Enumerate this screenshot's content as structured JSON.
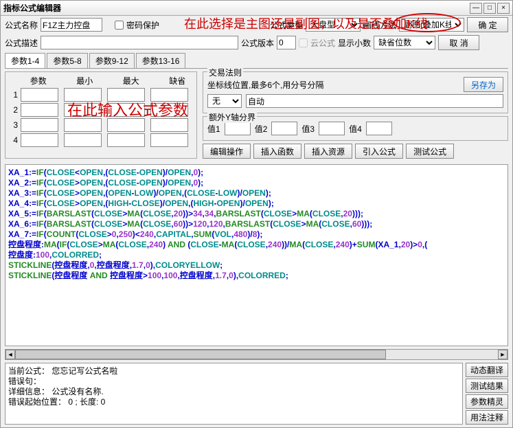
{
  "title": "指标公式编辑器",
  "window_buttons": {
    "min": "—",
    "max": "□",
    "close": "×"
  },
  "row1": {
    "name_label": "公式名称",
    "name_value": "F1Z主力控盘",
    "pwd_label": "密码保护",
    "type_label": "公式类型",
    "type_value": "大盘型",
    "draw_label": "画线方法",
    "draw_value": "副图(叠加K线)",
    "ok": "确  定"
  },
  "row2": {
    "desc_label": "公式描述",
    "desc_value": "",
    "ver_label": "公式版本",
    "ver_value": "0",
    "cloud_label": "云公式",
    "dec_label": "显示小数",
    "dec_value": "缺省位数",
    "cancel": "取  消"
  },
  "tabs": [
    "参数1-4",
    "参数5-8",
    "参数9-12",
    "参数13-16"
  ],
  "param_head": [
    "参数",
    "最小",
    "最大",
    "缺省"
  ],
  "param_nums": [
    "1",
    "2",
    "3",
    "4"
  ],
  "overlay_param": "在此输入公式参数",
  "annot_top": "在此选择是主图还是副图，以及是否叠加K线",
  "trade": {
    "legend": "交易法则",
    "hint": "坐标线位置,最多6个,用分号分隔",
    "save_as": "另存为",
    "none": "无",
    "auto": "自动"
  },
  "extra": {
    "legend": "额外Y轴分界",
    "v1": "值1",
    "v2": "值2",
    "v3": "值3",
    "v4": "值4"
  },
  "btns": {
    "edit": "编辑操作",
    "func": "插入函数",
    "res": "插入资源",
    "import": "引入公式",
    "test": "测试公式"
  },
  "code_lines": [
    [
      "XA_1:=",
      "IF",
      "(",
      "CLOSE",
      "<",
      "OPEN",
      ",(",
      "CLOSE",
      "-",
      "OPEN",
      ")/",
      "OPEN",
      ",",
      "0",
      ");"
    ],
    [
      "XA_2:=",
      "IF",
      "(",
      "CLOSE",
      ">",
      "OPEN",
      ",(",
      "CLOSE",
      "-",
      "OPEN",
      ")/",
      "OPEN",
      ",",
      "0",
      ");"
    ],
    [
      "XA_3:=",
      "IF",
      "(",
      "CLOSE",
      ">",
      "OPEN",
      ",(",
      "OPEN",
      "-",
      "LOW",
      ")/",
      "OPEN",
      ",(",
      "CLOSE",
      "-",
      "LOW",
      ")/",
      "OPEN",
      ");"
    ],
    [
      "XA_4:=",
      "IF",
      "(",
      "CLOSE",
      ">",
      "OPEN",
      ",(",
      "HIGH",
      "-",
      "CLOSE",
      ")/",
      "OPEN",
      ",(",
      "HIGH",
      "-",
      "OPEN",
      ")/",
      "OPEN",
      ");"
    ],
    [
      "XA_5:=",
      "IF",
      "(",
      "BARSLAST",
      "(",
      "CLOSE",
      ">",
      "MA",
      "(",
      "CLOSE",
      ",",
      "20",
      "))>",
      "34",
      ",",
      "34",
      ",",
      "BARSLAST",
      "(",
      "CLOSE",
      ">",
      "MA",
      "(",
      "CLOSE",
      ",",
      "20",
      ")));"
    ],
    [
      "XA_6:=",
      "IF",
      "(",
      "BARSLAST",
      "(",
      "CLOSE",
      ">",
      "MA",
      "(",
      "CLOSE",
      ",",
      "60",
      "))>",
      "120",
      ",",
      "120",
      ",",
      "BARSLAST",
      "(",
      "CLOSE",
      ">",
      "MA",
      "(",
      "CLOSE",
      ",",
      "60",
      ")));"
    ],
    [
      "XA_7:=",
      "IF",
      "(",
      "COUNT",
      "(",
      "CLOSE",
      ">",
      "0",
      ",",
      "250",
      ")<",
      "240",
      ",",
      "CAPITAL",
      ",",
      "SUM",
      "(",
      "VOL",
      ",",
      "480",
      ")/",
      "8",
      ");"
    ],
    [
      "控盘程度:",
      "MA",
      "(",
      "IF",
      "(",
      "CLOSE",
      ">",
      "MA",
      "(",
      "CLOSE",
      ",",
      "240",
      ")",
      " AND ",
      "(",
      "CLOSE",
      "-",
      "MA",
      "(",
      "CLOSE",
      ",",
      "240",
      "))/",
      "MA",
      "(",
      "CLOSE",
      ",",
      "240",
      ")+",
      "SUM",
      "(XA_1,",
      "20",
      ")>",
      "0",
      ",("
    ],
    [
      "控盘度:",
      "100",
      ",",
      "COLORRED",
      ";"
    ],
    [
      "",
      "STICKLINE",
      "(控盘程度,",
      "0",
      ",控盘程度,",
      "1.7",
      ",",
      "0",
      "),",
      "COLORYELLOW",
      ";"
    ],
    [
      "",
      "STICKLINE",
      "(控盘程度 ",
      "AND",
      " 控盘程度>",
      "100",
      ",",
      "100",
      ",控盘程度,",
      "1.7",
      ",",
      "0",
      "),",
      "COLORRED",
      ";"
    ]
  ],
  "status": {
    "l1": "当前公式：  您忘记写公式名啦",
    "l2": "错误句：",
    "l3": "详细信息：  公式没有名称.",
    "l4": "错误起始位置：  0 ;  长度:  0"
  },
  "side": {
    "b1": "动态翻译",
    "b2": "测试结果",
    "b3": "参数精灵",
    "b4": "用法注释"
  }
}
